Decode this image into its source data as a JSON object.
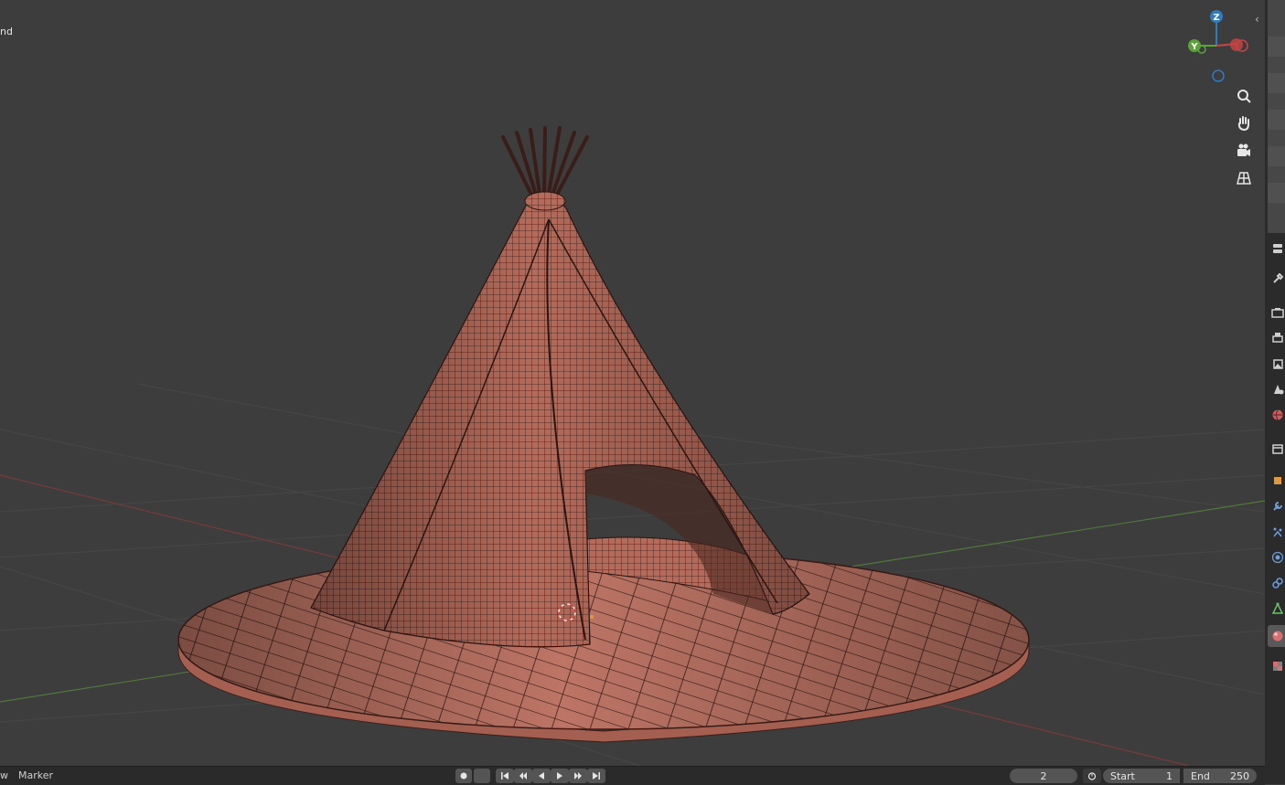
{
  "viewport": {
    "overlay_text": "nd",
    "object_name": "Tipi",
    "mesh_color": "#b9705f",
    "wire_color": "#2a1512",
    "floor_grid_color": "#4a4a4a",
    "x_axis_color": "#8a3b3b",
    "y_axis_color": "#5c8a3b"
  },
  "gizmo": {
    "z_label": "Z",
    "y_label": "Y",
    "z_color": "#2f7bc1",
    "y_color": "#5aa33a",
    "x_color": "#c94444"
  },
  "nav_icons": [
    "zoom-icon",
    "hand-pan-icon",
    "camera-icon",
    "grid-perspective-icon"
  ],
  "properties_tabs": [
    {
      "name": "tool-tab",
      "icon": "wrench-tool-icon",
      "color": "#cfcfcf"
    },
    {
      "name": "render-tab",
      "icon": "camera-back-icon",
      "color": "#cfcfcf"
    },
    {
      "name": "output-tab",
      "icon": "printer-icon",
      "color": "#cfcfcf"
    },
    {
      "name": "view-layer-tab",
      "icon": "image-stack-icon",
      "color": "#cfcfcf"
    },
    {
      "name": "scene-tab",
      "icon": "scene-cone-icon",
      "color": "#cfcfcf"
    },
    {
      "name": "world-tab",
      "icon": "world-globe-icon",
      "color": "#d45a5a"
    },
    {
      "name": "collection-tab",
      "icon": "collection-box-icon",
      "color": "#cfcfcf"
    },
    {
      "name": "object-tab",
      "icon": "object-square-icon",
      "color": "#e29a3a"
    },
    {
      "name": "modifier-tab",
      "icon": "wrench-icon",
      "color": "#6b9fe0"
    },
    {
      "name": "particles-tab",
      "icon": "particles-icon",
      "color": "#6b9fe0"
    },
    {
      "name": "physics-tab",
      "icon": "physics-orbit-icon",
      "color": "#6b9fe0"
    },
    {
      "name": "constraints-tab",
      "icon": "constraint-link-icon",
      "color": "#6b9fe0"
    },
    {
      "name": "data-tab",
      "icon": "mesh-triangle-icon",
      "color": "#6cc06c"
    },
    {
      "name": "material-tab",
      "icon": "material-sphere-icon",
      "color": "#d97070"
    },
    {
      "name": "texture-tab",
      "icon": "checker-texture-icon",
      "color": "#d97070"
    }
  ],
  "timeline": {
    "menu_fragment": "w",
    "marker_label": "Marker",
    "current_frame": "2",
    "start_label": "Start",
    "start_value": "1",
    "end_label": "End",
    "end_value": "250"
  }
}
